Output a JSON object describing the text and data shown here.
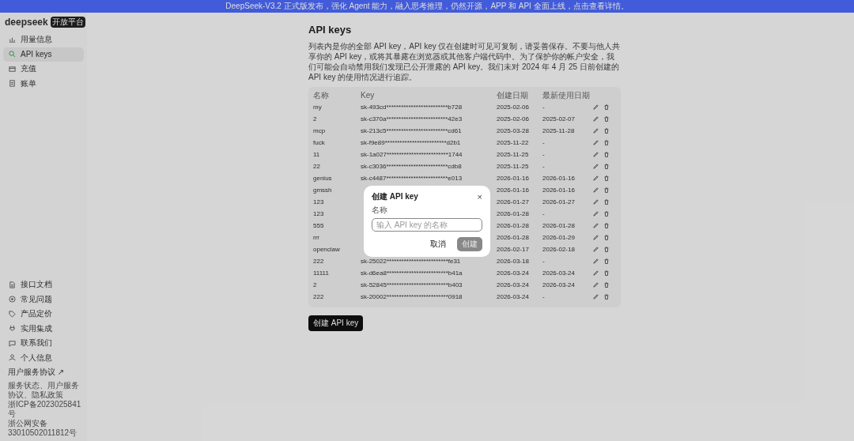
{
  "banner": {
    "text": "DeepSeek-V3.2 正式版发布，强化 Agent 能力，融入思考推理，仍然开源，APP 和 API 全面上线，点击查看详情。"
  },
  "sidebar": {
    "logo": "deepseek",
    "badge": "开放平台",
    "items": [
      {
        "label": "用量信息",
        "selected": false
      },
      {
        "label": "API keys",
        "selected": true
      },
      {
        "label": "充值",
        "selected": false
      },
      {
        "label": "账单",
        "selected": false
      }
    ],
    "bottom_items": [
      {
        "label": "接口文档"
      },
      {
        "label": "常见问题"
      },
      {
        "label": "产品定价"
      },
      {
        "label": "实用集成"
      },
      {
        "label": "联系我们"
      },
      {
        "label": "个人信息"
      }
    ],
    "link": "用户服务协议 ↗",
    "footer": [
      "服务状态、用户服务协议、隐私政策",
      "浙ICP备2023025841号",
      "浙公网安备 33010502011812号"
    ]
  },
  "page": {
    "title": "API keys",
    "description": "列表内是你的全部 API key，API key 仅在创建时可见可复制，请妥善保存。不要与他人共享你的 API key，或将其暴露在浏览器或其他客户端代码中。为了保护你的帐户安全，我们可能会自动禁用我们发现已公开泄露的 API key。我们未对 2024 年 4 月 25 日前创建的 API key 的使用情况进行追踪。",
    "table": {
      "columns": [
        "名称",
        "Key",
        "创建日期",
        "最新使用日期"
      ],
      "rows": [
        {
          "name": "my",
          "key": "sk-493cd*************************b728",
          "created": "2025-02-06",
          "last_used": "-"
        },
        {
          "name": "2",
          "key": "sk-c370a*************************42e3",
          "created": "2025-02-06",
          "last_used": "2025-02-07"
        },
        {
          "name": "mcp",
          "key": "sk-213c5*************************cd61",
          "created": "2025-03-28",
          "last_used": "2025-11-28"
        },
        {
          "name": "fuck",
          "key": "sk-f9e89*************************d2b1",
          "created": "2025-11-22",
          "last_used": "-"
        },
        {
          "name": "11",
          "key": "sk-1a027*************************1744",
          "created": "2025-11-25",
          "last_used": "-"
        },
        {
          "name": "22",
          "key": "sk-c3036*************************cdb8",
          "created": "2025-11-25",
          "last_used": "-"
        },
        {
          "name": "genius",
          "key": "sk-c4487*************************e013",
          "created": "2026-01-16",
          "last_used": "2026-01-16"
        },
        {
          "name": "gmssh",
          "created": "2026-01-16",
          "last_used": "2026-01-16"
        },
        {
          "name": "123",
          "created": "2026-01-27",
          "last_used": "2026-01-27"
        },
        {
          "name": "123",
          "created": "2026-01-28",
          "last_used": "-"
        },
        {
          "name": "555",
          "created": "2026-01-28",
          "last_used": "2026-01-28"
        },
        {
          "name": "rrr",
          "created": "2026-01-28",
          "last_used": "2026-01-29"
        },
        {
          "name": "openclaw",
          "created": "2026-02-17",
          "last_used": "2026-02-18"
        },
        {
          "name": "222",
          "key": "sk-25022*************************fe31",
          "created": "2026-03-18",
          "last_used": "-"
        },
        {
          "name": "11111",
          "key": "sk-d6ea8*************************b41a",
          "created": "2026-03-24",
          "last_used": "2026-03-24"
        },
        {
          "name": "2",
          "key": "sk-52845*************************b403",
          "created": "2026-03-24",
          "last_used": "2026-03-24"
        },
        {
          "name": "222",
          "key": "sk-20002*************************0918",
          "created": "2026-03-24",
          "last_used": "-"
        }
      ]
    },
    "create_button": "创建 API key"
  },
  "dialog": {
    "title": "创建 API key",
    "close": "×",
    "field_label": "名称",
    "placeholder": "输入 API key 的名称",
    "buttons": [
      {
        "label": "取消",
        "kind": "cancel",
        "disabled": false
      },
      {
        "label": "创建",
        "kind": "confirm",
        "disabled": true
      }
    ]
  }
}
